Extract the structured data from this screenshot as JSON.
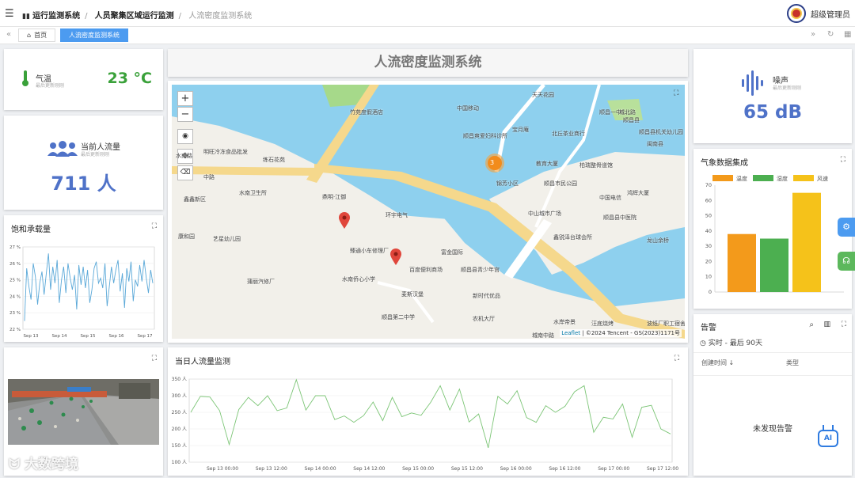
{
  "header": {
    "menu_glyph": "☰",
    "breadcrumb": [
      "运行监测系统",
      "人员聚集区域运行监测",
      "人流密度监测系统"
    ],
    "user": "超级管理员"
  },
  "tabs": {
    "home": "首页",
    "current": "人流密度监测系统"
  },
  "page_title": "人流密度监测系统",
  "temperature": {
    "label": "气温",
    "sub": "最后更新刚刚",
    "value": "23 °C",
    "color": "#3aa13a"
  },
  "flow": {
    "label": "当前人流量",
    "sub": "最后更新刚刚",
    "value": "711 人",
    "color": "#4f72c8"
  },
  "noise": {
    "label": "噪声",
    "sub": "最后更新刚刚",
    "value": "65 dB",
    "color": "#4f72c8"
  },
  "saturation": {
    "title": "饱和承载量"
  },
  "daily": {
    "title": "当日人流量监测"
  },
  "weather": {
    "title": "气象数据集成"
  },
  "alarm": {
    "title": "告警",
    "range": "实时 - 最后 90天",
    "col_time": "创建时间",
    "col_type": "类型",
    "empty": "未发现告警"
  },
  "map": {
    "attribution_link": "Leaflet",
    "attribution": "| ©2024 Tencent - GS(2023)1171号",
    "cluster": "3",
    "labels": [
      {
        "t": "竹苑度假酒店"
      },
      {
        "t": "中国移动"
      },
      {
        "t": "顺昌爽爱妇科诊所"
      },
      {
        "t": "宝月庵"
      },
      {
        "t": "北丘茶业商行"
      },
      {
        "t": "顺昌县机关幼儿园"
      },
      {
        "t": "明旺冷冻食品批发"
      },
      {
        "t": "练石花苑"
      },
      {
        "t": "教育大厦"
      },
      {
        "t": "柏瑞整骨道馆"
      },
      {
        "t": "顺昌市民公园"
      },
      {
        "t": "中国电信"
      },
      {
        "t": "鸿辉大厦"
      },
      {
        "t": "中山城市广场"
      },
      {
        "t": "顺昌县中医院"
      },
      {
        "t": "鑫锐泽台球会所"
      },
      {
        "t": "龙山余桥"
      },
      {
        "t": "水南卫生所"
      },
      {
        "t": "鼎明·江御"
      },
      {
        "t": "鑫鑫新区"
      },
      {
        "t": "康和园"
      },
      {
        "t": "艺星幼儿园"
      },
      {
        "t": "环宇电气"
      },
      {
        "t": "臻通小车修理厂"
      },
      {
        "t": "富金国际"
      },
      {
        "t": "百度便利商场"
      },
      {
        "t": "顺昌县青少年宫"
      },
      {
        "t": "水南侨心小学"
      },
      {
        "t": "蒲丽汽修厂"
      },
      {
        "t": "麦斯汉堡"
      },
      {
        "t": "新时代优品"
      },
      {
        "t": "顺昌第二中学"
      },
      {
        "t": "农机大厅"
      },
      {
        "t": "水岸帝景"
      },
      {
        "t": "汪底烧烤"
      },
      {
        "t": "波纸厂职工宿舍"
      },
      {
        "t": "锦芳小区"
      },
      {
        "t": "天天花园"
      },
      {
        "t": "顺昌一中"
      },
      {
        "t": "城北路"
      },
      {
        "t": "中路"
      },
      {
        "t": "城南中路"
      },
      {
        "t": "水南路"
      },
      {
        "t": "顺昌县"
      },
      {
        "t": "闽南县"
      }
    ]
  },
  "watermark": "大数跨境",
  "ai_label": "AI",
  "chart_data": [
    {
      "type": "line",
      "title": "饱和承载量",
      "x_ticks": [
        "Sep 13",
        "Sep 14",
        "Sep 15",
        "Sep 16",
        "Sep 17"
      ],
      "y_ticks": [
        "22 %",
        "23 %",
        "24 %",
        "25 %",
        "26 %",
        "27 %"
      ],
      "ylim": [
        22,
        27
      ],
      "color": "#5aa8d8",
      "values": [
        22.5,
        25.7,
        24.6,
        23.8,
        26.0,
        25.2,
        23.5,
        24.8,
        25.5,
        24.1,
        25.4,
        26.6,
        24.4,
        25.8,
        24.8,
        26.2,
        23.6,
        25.0,
        25.8,
        24.2,
        26.0,
        25.1,
        24.4,
        25.3,
        23.2,
        25.9,
        24.7,
        25.8,
        24.5,
        25.6,
        23.6,
        24.4,
        25.7,
        26.1,
        24.8,
        25.1,
        24.5,
        26.0,
        23.4,
        24.6,
        25.8,
        24.8,
        25.6,
        26.2,
        24.3,
        25.4,
        23.3,
        25.7,
        24.9,
        26.1,
        23.7,
        25.0,
        24.6,
        25.9,
        24.9,
        26.2,
        25.1,
        24.2,
        25.6,
        24.8
      ]
    },
    {
      "type": "line",
      "title": "当日人流量监测",
      "x_ticks": [
        "Sep 13 00:00",
        "Sep 13 12:00",
        "Sep 14 00:00",
        "Sep 14 12:00",
        "Sep 15 00:00",
        "Sep 15 12:00",
        "Sep 16 00:00",
        "Sep 16 12:00",
        "Sep 17 00:00",
        "Sep 17 12:00"
      ],
      "y_ticks": [
        "100 人",
        "150 人",
        "200 人",
        "250 人",
        "300 人",
        "350 人"
      ],
      "ylim": [
        100,
        350
      ],
      "color": "#7cc576",
      "values": [
        250,
        298,
        296,
        255,
        153,
        258,
        295,
        270,
        300,
        255,
        263,
        348,
        257,
        300,
        300,
        228,
        239,
        220,
        240,
        281,
        225,
        295,
        237,
        248,
        241,
        280,
        330,
        257,
        320,
        221,
        245,
        143,
        298,
        275,
        315,
        234,
        220,
        270,
        250,
        268,
        312,
        330,
        190,
        235,
        230,
        275,
        175,
        265,
        271,
        200,
        185
      ]
    },
    {
      "type": "bar",
      "title": "气象数据集成",
      "series": [
        {
          "name": "温度",
          "value": 38,
          "color": "#f39a1b"
        },
        {
          "name": "湿度",
          "value": 35,
          "color": "#4caf50"
        },
        {
          "name": "风速",
          "value": 65,
          "color": "#f5c21a"
        }
      ],
      "y_ticks": [
        "0",
        "10",
        "20",
        "30",
        "40",
        "50",
        "60",
        "70"
      ],
      "ylim": [
        0,
        70
      ]
    }
  ]
}
